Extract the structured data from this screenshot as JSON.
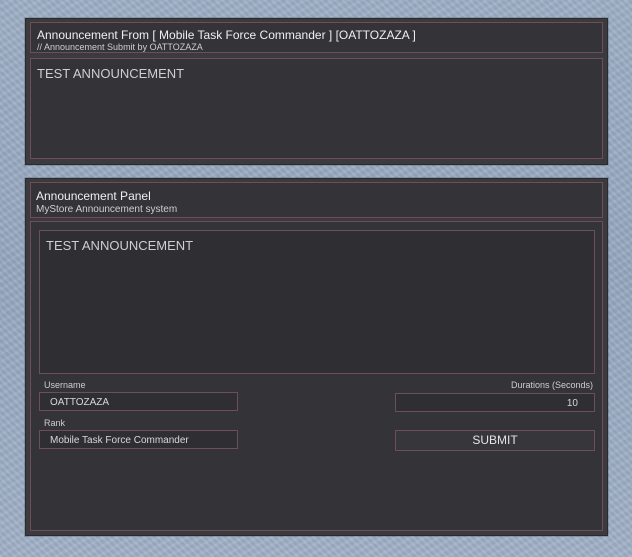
{
  "announcement_display": {
    "title": "Announcement From [ Mobile Task Force Commander ] [OATTOZAZA ]",
    "subtitle": "// Announcement Submit by OATTOZAZA",
    "message": "TEST ANNOUNCEMENT"
  },
  "announcement_panel": {
    "title": "Announcement Panel",
    "subtitle": "MyStore Announcement system",
    "message_value": "TEST ANNOUNCEMENT",
    "username_label": "Username",
    "username_value": "OATTOZAZA",
    "rank_label": "Rank",
    "rank_value": "Mobile Task Force Commander",
    "duration_label": "Durations (Seconds)",
    "duration_value": "10",
    "submit_label": "SUBMIT"
  }
}
